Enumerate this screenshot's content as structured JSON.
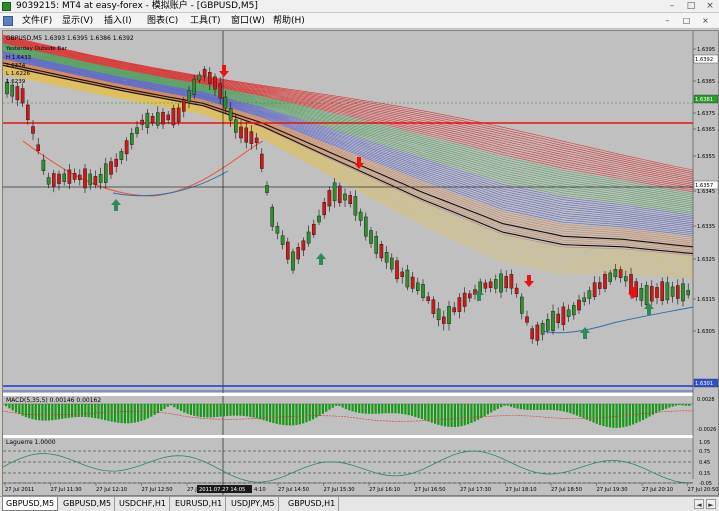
{
  "window": {
    "title": "9039215: MT4 at easy-forex - 模拟账户 - [GBPUSD,M5]",
    "controls": [
      "–",
      "□",
      "×"
    ]
  },
  "menu": {
    "items": [
      "文件(F)",
      "显示(V)",
      "插入(I)",
      "图表(C)",
      "工具(T)",
      "窗口(W)",
      "帮助(H)"
    ],
    "mdi_controls": [
      "–",
      "□",
      "×"
    ]
  },
  "chart": {
    "symbol_info": "GBPUSD,M5 1.6393 1.6395 1.6386 1.6392",
    "indicator_info_lines": [
      "Yesterday Outside Bar",
      "H 1.6433",
      "1.6374",
      "L 1.6226",
      "1.6239"
    ],
    "crosshair_time_label": "2011.07.27 14:05",
    "price_ticks": [
      "1.6395",
      "1.6385",
      "1.6375",
      "1.6365",
      "1.6355",
      "1.6345",
      "1.6335",
      "1.6325",
      "1.6315",
      "1.6305"
    ],
    "price_badges": [
      "1.6392",
      "1.6381",
      "1.6357",
      "1.6301"
    ],
    "time_ticks": [
      "27 Jul 2011",
      "27 Jul 11:30",
      "27 Jul 12:10",
      "27 Jul 12:50",
      "27 Jul 13:30",
      "",
      "27 Jul 14:50",
      "27 Jul 15:30",
      "27 Jul 16:10",
      "27 Jul 16:50",
      "27 Jul 17:30",
      "27 Jul 18:10",
      "27 Jul 18:50",
      "27 Jul 19:30",
      "27 Jul 20:10",
      "27 Jul 20:50"
    ],
    "time_tick_partial": "4:10",
    "macd_label": "MACD(5,35,5) 0.00146 0.00162",
    "macd_ticks": [
      "0.0028",
      "-0.0026"
    ],
    "laguerre_label": "Laguerre 1.0000",
    "laguerre_ticks": [
      "1.05",
      "0.75",
      "0.45",
      "0.15",
      "-0.05"
    ],
    "colors": {
      "bg": "#c0c0c0",
      "bull": "#2f8f2f",
      "bear": "#cc1a1a",
      "macd_hist": "#159a15",
      "arrow_up": "#2e8b57",
      "arrow_down": "#ee1111"
    }
  },
  "tabs": {
    "items": [
      "GBPUSD,M5",
      "GBPUSD,M5",
      "USDCHF,H1",
      "EURUSD,H1",
      "USDJPY,M5",
      "GBPUSD,H1"
    ],
    "active_index": 0,
    "nav": [
      "◄",
      "►"
    ]
  }
}
